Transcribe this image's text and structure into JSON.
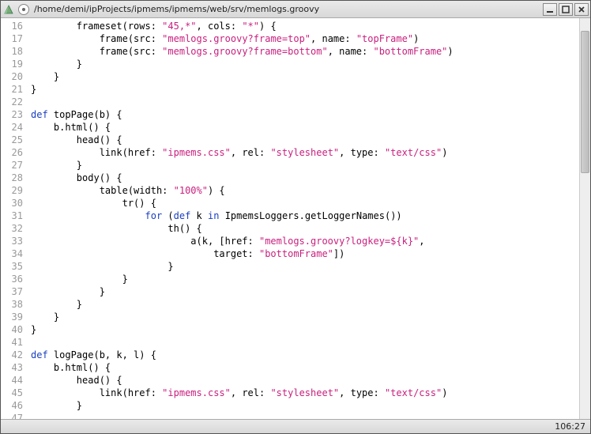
{
  "window": {
    "title": "/home/demi/ipProjects/ipmems/ipmems/web/srv/memlogs.groovy"
  },
  "status": {
    "position": "106:27"
  },
  "gutter": {
    "start": 16,
    "end": 47
  },
  "code": {
    "lines": [
      [
        [
          "",
          "        frameset(rows: "
        ],
        [
          "str",
          "\"45,*\""
        ],
        [
          "",
          ", cols: "
        ],
        [
          "str",
          "\"*\""
        ],
        [
          "",
          ") {"
        ]
      ],
      [
        [
          "",
          "            frame(src: "
        ],
        [
          "str",
          "\"memlogs.groovy?frame=top\""
        ],
        [
          "",
          ", name: "
        ],
        [
          "str",
          "\"topFrame\""
        ],
        [
          "",
          ")"
        ]
      ],
      [
        [
          "",
          "            frame(src: "
        ],
        [
          "str",
          "\"memlogs.groovy?frame=bottom\""
        ],
        [
          "",
          ", name: "
        ],
        [
          "str",
          "\"bottomFrame\""
        ],
        [
          "",
          ")"
        ]
      ],
      [
        [
          "",
          "        }"
        ]
      ],
      [
        [
          "",
          "    }"
        ]
      ],
      [
        [
          "",
          "}"
        ]
      ],
      [
        [
          "",
          ""
        ]
      ],
      [
        [
          "kw",
          "def"
        ],
        [
          "",
          " topPage(b) {"
        ]
      ],
      [
        [
          "",
          "    b.html() {"
        ]
      ],
      [
        [
          "",
          "        head() {"
        ]
      ],
      [
        [
          "",
          "            link(href: "
        ],
        [
          "str",
          "\"ipmems.css\""
        ],
        [
          "",
          ", rel: "
        ],
        [
          "str",
          "\"stylesheet\""
        ],
        [
          "",
          ", type: "
        ],
        [
          "str",
          "\"text/css\""
        ],
        [
          "",
          ")"
        ]
      ],
      [
        [
          "",
          "        }"
        ]
      ],
      [
        [
          "",
          "        body() {"
        ]
      ],
      [
        [
          "",
          "            table(width: "
        ],
        [
          "str",
          "\"100%\""
        ],
        [
          "",
          ") {"
        ]
      ],
      [
        [
          "",
          "                tr() {"
        ]
      ],
      [
        [
          "",
          "                    "
        ],
        [
          "kw",
          "for"
        ],
        [
          "",
          " ("
        ],
        [
          "kw",
          "def"
        ],
        [
          "",
          " k "
        ],
        [
          "kw",
          "in"
        ],
        [
          "",
          " IpmemsLoggers.getLoggerNames())"
        ]
      ],
      [
        [
          "",
          "                        th() {"
        ]
      ],
      [
        [
          "",
          "                            a(k, [href: "
        ],
        [
          "str",
          "\"memlogs.groovy?logkey=${k}\""
        ],
        [
          "",
          ","
        ]
      ],
      [
        [
          "",
          "                                target: "
        ],
        [
          "str",
          "\"bottomFrame\""
        ],
        [
          "",
          "])"
        ]
      ],
      [
        [
          "",
          "                        }"
        ]
      ],
      [
        [
          "",
          "                }"
        ]
      ],
      [
        [
          "",
          "            }"
        ]
      ],
      [
        [
          "",
          "        }"
        ]
      ],
      [
        [
          "",
          "    }"
        ]
      ],
      [
        [
          "",
          "}"
        ]
      ],
      [
        [
          "",
          ""
        ]
      ],
      [
        [
          "kw",
          "def"
        ],
        [
          "",
          " logPage(b, k, l) {"
        ]
      ],
      [
        [
          "",
          "    b.html() {"
        ]
      ],
      [
        [
          "",
          "        head() {"
        ]
      ],
      [
        [
          "",
          "            link(href: "
        ],
        [
          "str",
          "\"ipmems.css\""
        ],
        [
          "",
          ", rel: "
        ],
        [
          "str",
          "\"stylesheet\""
        ],
        [
          "",
          ", type: "
        ],
        [
          "str",
          "\"text/css\""
        ],
        [
          "",
          ")"
        ]
      ],
      [
        [
          "",
          "        }"
        ]
      ],
      [
        [
          "",
          ""
        ]
      ]
    ]
  }
}
